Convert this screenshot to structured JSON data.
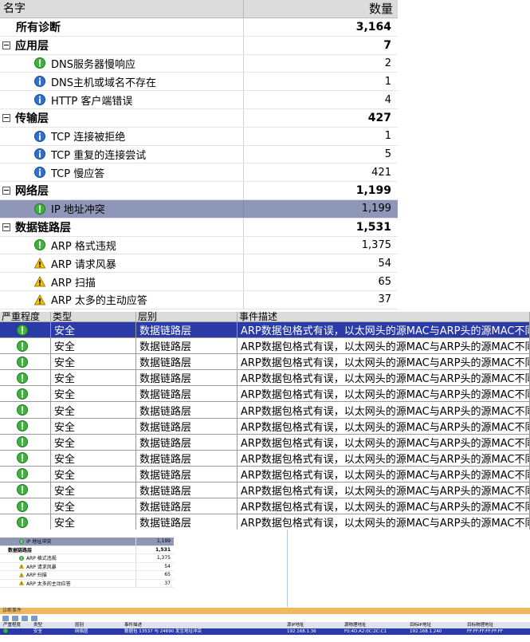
{
  "tree": {
    "col_name": "名字",
    "col_count": "数量",
    "rows": [
      {
        "label": "所有诊断",
        "count": "3,164",
        "level": "root",
        "icon": "",
        "bold": true
      },
      {
        "label": "应用层",
        "count": "7",
        "level": "group",
        "icon": "",
        "bold": true
      },
      {
        "label": "DNS服务器慢响应",
        "count": "2",
        "level": "leaf",
        "icon": "green-alert-icon"
      },
      {
        "label": "DNS主机或域名不存在",
        "count": "1",
        "level": "leaf",
        "icon": "info-icon"
      },
      {
        "label": "HTTP 客户端错误",
        "count": "4",
        "level": "leaf",
        "icon": "info-icon"
      },
      {
        "label": "传输层",
        "count": "427",
        "level": "group",
        "icon": "",
        "bold": true
      },
      {
        "label": "TCP 连接被拒绝",
        "count": "1",
        "level": "leaf",
        "icon": "info-icon"
      },
      {
        "label": "TCP 重复的连接尝试",
        "count": "5",
        "level": "leaf",
        "icon": "info-icon"
      },
      {
        "label": "TCP 慢应答",
        "count": "421",
        "level": "leaf",
        "icon": "info-icon"
      },
      {
        "label": "网络层",
        "count": "1,199",
        "level": "group",
        "icon": "",
        "bold": true
      },
      {
        "label": "IP 地址冲突",
        "count": "1,199",
        "level": "leaf",
        "icon": "green-alert-icon",
        "selected": true
      },
      {
        "label": "数据链路层",
        "count": "1,531",
        "level": "group",
        "icon": "",
        "bold": true
      },
      {
        "label": "ARP 格式违规",
        "count": "1,375",
        "level": "leaf",
        "icon": "green-alert-icon"
      },
      {
        "label": "ARP 请求风暴",
        "count": "54",
        "level": "leaf",
        "icon": "warning-icon"
      },
      {
        "label": "ARP 扫描",
        "count": "65",
        "level": "leaf",
        "icon": "warning-icon"
      },
      {
        "label": "ARP 太多的主动应答",
        "count": "37",
        "level": "leaf",
        "icon": "warning-icon"
      }
    ]
  },
  "events": {
    "headers": [
      "严重程度",
      "类型",
      "层别",
      "事件描述"
    ],
    "rows": [
      {
        "type": "安全",
        "layer": "数据链路层",
        "desc": "ARP数据包格式有误，以太网头的源MAC与ARP头的源MAC不同!",
        "selected": true
      },
      {
        "type": "安全",
        "layer": "数据链路层",
        "desc": "ARP数据包格式有误，以太网头的源MAC与ARP头的源MAC不同!"
      },
      {
        "type": "安全",
        "layer": "数据链路层",
        "desc": "ARP数据包格式有误，以太网头的源MAC与ARP头的源MAC不同!"
      },
      {
        "type": "安全",
        "layer": "数据链路层",
        "desc": "ARP数据包格式有误，以太网头的源MAC与ARP头的源MAC不同!"
      },
      {
        "type": "安全",
        "layer": "数据链路层",
        "desc": "ARP数据包格式有误，以太网头的源MAC与ARP头的源MAC不同!"
      },
      {
        "type": "安全",
        "layer": "数据链路层",
        "desc": "ARP数据包格式有误，以太网头的源MAC与ARP头的源MAC不同!"
      },
      {
        "type": "安全",
        "layer": "数据链路层",
        "desc": "ARP数据包格式有误，以太网头的源MAC与ARP头的源MAC不同!"
      },
      {
        "type": "安全",
        "layer": "数据链路层",
        "desc": "ARP数据包格式有误，以太网头的源MAC与ARP头的源MAC不同!"
      },
      {
        "type": "安全",
        "layer": "数据链路层",
        "desc": "ARP数据包格式有误，以太网头的源MAC与ARP头的源MAC不同!"
      },
      {
        "type": "安全",
        "layer": "数据链路层",
        "desc": "ARP数据包格式有误，以太网头的源MAC与ARP头的源MAC不同!"
      },
      {
        "type": "安全",
        "layer": "数据链路层",
        "desc": "ARP数据包格式有误，以太网头的源MAC与ARP头的源MAC不同!"
      },
      {
        "type": "安全",
        "layer": "数据链路层",
        "desc": "ARP数据包格式有误，以太网头的源MAC与ARP头的源MAC不同!"
      },
      {
        "type": "安全",
        "layer": "数据链路层",
        "desc": "ARP数据包格式有误，以太网头的源MAC与ARP头的源MAC不同!"
      }
    ]
  },
  "mini": {
    "rows": [
      {
        "label": "IP 地址冲突",
        "count": "1,199",
        "icon": "green-alert-icon",
        "selected": true
      },
      {
        "label": "数据链路层",
        "count": "1,531",
        "group": true
      },
      {
        "label": "ARP 格式违规",
        "count": "1,375",
        "icon": "green-alert-icon"
      },
      {
        "label": "ARP 请求风暴",
        "count": "54",
        "icon": "warning-icon"
      },
      {
        "label": "ARP 扫描",
        "count": "65",
        "icon": "warning-icon"
      },
      {
        "label": "ARP 太多的主动应答",
        "count": "37",
        "icon": "warning-icon"
      }
    ],
    "panel_title": "诊断事件",
    "headers": [
      "严重程度",
      "类型",
      "层别",
      "事件描述",
      "源IP地址",
      "源物理地址",
      "目标IP地址",
      "目标物理地址"
    ],
    "row": [
      "安全",
      "网络层",
      "数据包 13537 与 24690 发生地址冲突",
      "192.168.1.36",
      "F0:4D:A2:0C:2C:C1",
      "192.168.1.240",
      "FF:FF:FF:FF:FF:FF"
    ]
  },
  "colors": {
    "selected_tree": "#8f97b8",
    "selected_event": "#2a3aa7",
    "header_bg": "#dcdcdc"
  }
}
